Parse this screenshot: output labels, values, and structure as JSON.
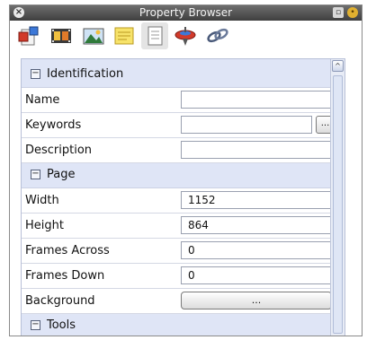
{
  "window": {
    "title": "Property Browser",
    "close_icon": "close-icon",
    "restore_icon": "restore-icon",
    "options_icon": "options-icon"
  },
  "toolbar": {
    "tools": [
      {
        "name": "document-tool-icon"
      },
      {
        "name": "filmstrip-tool-icon"
      },
      {
        "name": "image-tool-icon"
      },
      {
        "name": "notes-tool-icon"
      },
      {
        "name": "page-tool-icon",
        "active": true
      },
      {
        "name": "spinning-top-tool-icon"
      },
      {
        "name": "link-tool-icon"
      }
    ]
  },
  "properties": {
    "identification": {
      "label": "Identification",
      "toggle": "−",
      "name_label": "Name",
      "name_value": "",
      "keywords_label": "Keywords",
      "keywords_value": "",
      "keywords_button": "...",
      "description_label": "Description",
      "description_value": ""
    },
    "page": {
      "label": "Page",
      "toggle": "−",
      "width_label": "Width",
      "width_value": "1152",
      "height_label": "Height",
      "height_value": "864",
      "frames_across_label": "Frames Across",
      "frames_across_value": "0",
      "frames_down_label": "Frames Down",
      "frames_down_value": "0",
      "background_label": "Background",
      "background_button": "..."
    },
    "tools": {
      "label": "Tools",
      "toggle": "−"
    }
  },
  "scrollbar": {
    "up_arrow": "^"
  }
}
